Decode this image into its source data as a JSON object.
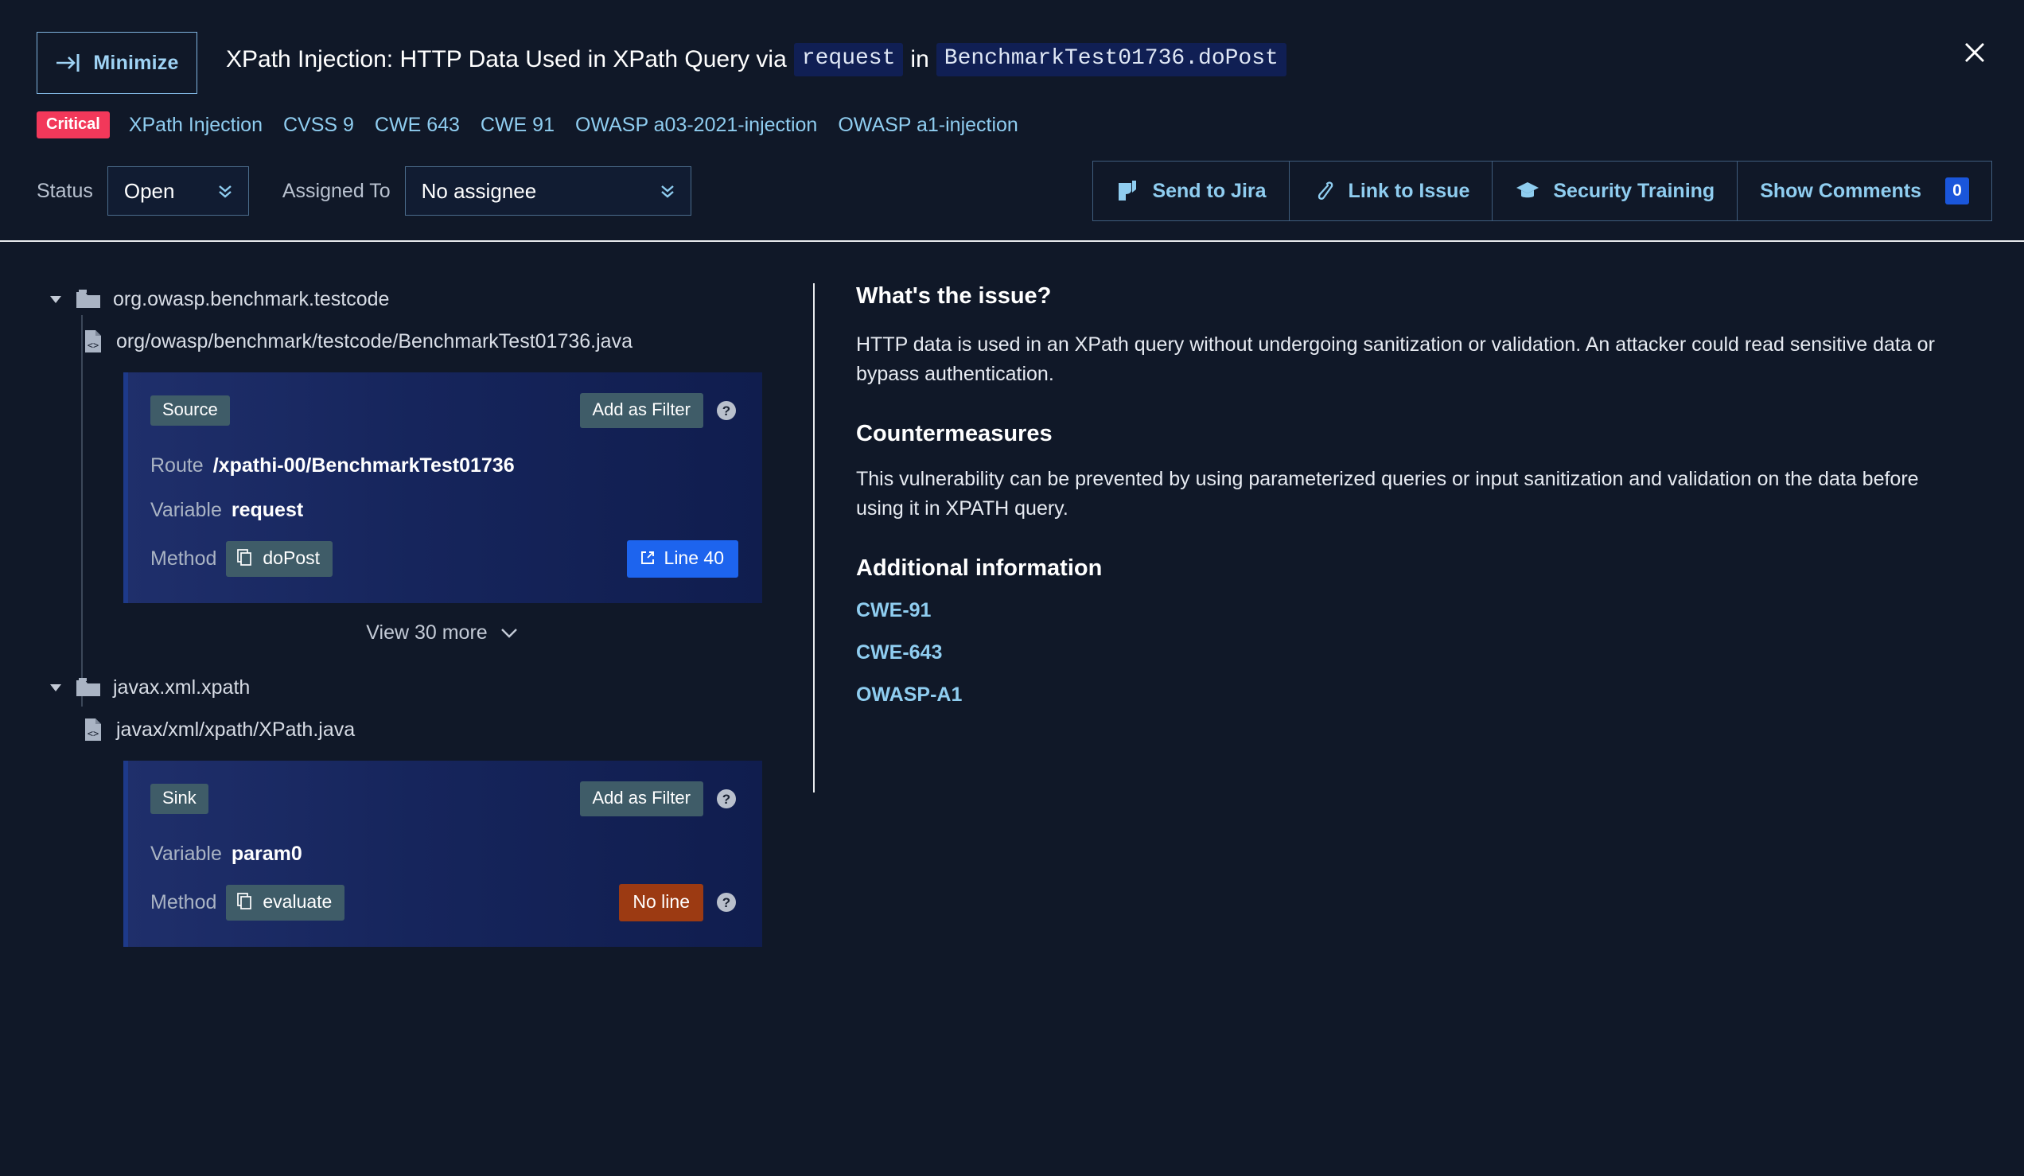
{
  "header": {
    "minimize_label": "Minimize",
    "title_part1": "XPath Injection: HTTP Data Used in XPath Query via",
    "title_code1": "request",
    "title_part2": "in",
    "title_code2": "BenchmarkTest01736.doPost",
    "close_icon": "close-icon"
  },
  "tags": {
    "severity": "Critical",
    "items": [
      "XPath Injection",
      "CVSS 9",
      "CWE 643",
      "CWE 91",
      "OWASP a03-2021-injection",
      "OWASP a1-injection"
    ]
  },
  "controls": {
    "status_label": "Status",
    "status_value": "Open",
    "assigned_label": "Assigned To",
    "assignee_value": "No assignee",
    "actions": [
      {
        "label": "Send to Jira",
        "icon": "jira-icon"
      },
      {
        "label": "Link to Issue",
        "icon": "link-icon"
      },
      {
        "label": "Security Training",
        "icon": "graduation-cap-icon"
      },
      {
        "label": "Show Comments",
        "icon": "none",
        "count": "0"
      }
    ]
  },
  "tree": {
    "groups": [
      {
        "package": "org.owasp.benchmark.testcode",
        "file": "org/owasp/benchmark/testcode/BenchmarkTest01736.java",
        "card": {
          "kind": "Source",
          "filter_label": "Add as Filter",
          "rows": [
            {
              "key": "Route",
              "value": "/xpathi-00/BenchmarkTest01736"
            },
            {
              "key": "Variable",
              "value": "request"
            }
          ],
          "method_key": "Method",
          "method_value": "doPost",
          "line_label": "Line 40",
          "line_type": "link"
        },
        "view_more": "View 30 more"
      },
      {
        "package": "javax.xml.xpath",
        "file": "javax/xml/xpath/XPath.java",
        "card": {
          "kind": "Sink",
          "filter_label": "Add as Filter",
          "rows": [
            {
              "key": "Variable",
              "value": "param0"
            }
          ],
          "method_key": "Method",
          "method_value": "evaluate",
          "line_label": "No line",
          "line_type": "none"
        }
      }
    ]
  },
  "details": {
    "issue_title": "What's the issue?",
    "issue_text": "HTTP data is used in an XPath query without undergoing sanitization or validation. An attacker could read sensitive data or bypass authentication.",
    "countermeasures_title": "Countermeasures",
    "countermeasures_text": "This vulnerability can be prevented by using parameterized queries or input sanitization and validation on the data before using it in XPATH query.",
    "additional_title": "Additional information",
    "links": [
      "CWE-91",
      "CWE-643",
      "OWASP-A1"
    ]
  },
  "colors": {
    "page_bg": "#101828",
    "accent_link": "#8fcdf0",
    "critical": "#f2385a",
    "primary_button": "#1d64ee",
    "warning": "#9c3a12",
    "card_accent": "#1e3a8a"
  }
}
